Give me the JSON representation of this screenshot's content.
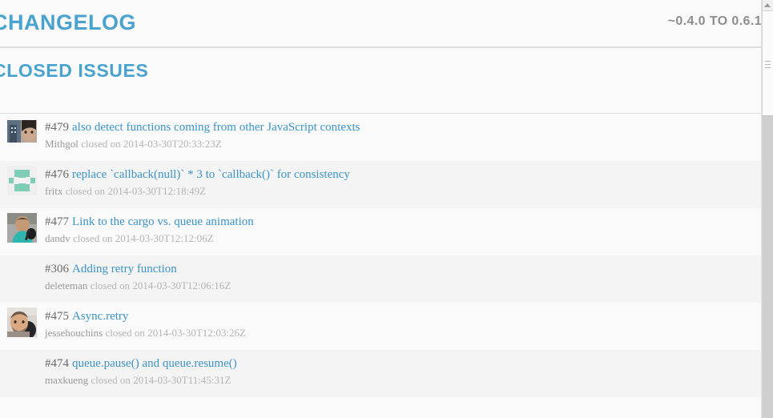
{
  "header": {
    "title": "CHANGELOG",
    "version_range": "~0.4.0 TO 0.6.1"
  },
  "section": {
    "title": "CLOSED ISSUES"
  },
  "colors": {
    "link_blue": "#3b93c6",
    "heading_blue": "#4aa3cf",
    "meta_gray": "#b5b5b5",
    "identicon_green": "#7fcdb6",
    "page_bg": "#fafafa",
    "row_alt_bg": "#f4f4f4"
  },
  "issues": [
    {
      "number": "#479",
      "title": "also detect functions coming from other JavaScript contexts",
      "author": "Mithgol",
      "closed_label": "closed on",
      "date": "2014-03-30T20:33:23Z",
      "avatar": "photo-building",
      "has_avatar": true
    },
    {
      "number": "#476",
      "title": "replace `callback(null)` * 3 to `callback()` for consistency",
      "author": "fritx",
      "closed_label": "closed on",
      "date": "2014-03-30T12:18:49Z",
      "avatar": "identicon",
      "has_avatar": true
    },
    {
      "number": "#477",
      "title": "Link to the cargo vs. queue animation",
      "author": "dandv",
      "closed_label": "closed on",
      "date": "2014-03-30T12:12:06Z",
      "avatar": "photo-person-teal",
      "has_avatar": true
    },
    {
      "number": "#306",
      "title": "Adding retry function",
      "author": "deleteman",
      "closed_label": "closed on",
      "date": "2014-03-30T12:06:16Z",
      "avatar": "none",
      "has_avatar": false
    },
    {
      "number": "#475",
      "title": "Async.retry",
      "author": "jessehouchins",
      "closed_label": "closed on",
      "date": "2014-03-30T12:03:26Z",
      "avatar": "photo-beard",
      "has_avatar": true
    },
    {
      "number": "#474",
      "title": "queue.pause() and queue.resume()",
      "author": "maxkueng",
      "closed_label": "closed on",
      "date": "2014-03-30T11:45:31Z",
      "avatar": "none",
      "has_avatar": false
    }
  ],
  "scrollbar": {
    "up_arrow": "chevron-up-icon",
    "thumb_position_percent": 0
  }
}
